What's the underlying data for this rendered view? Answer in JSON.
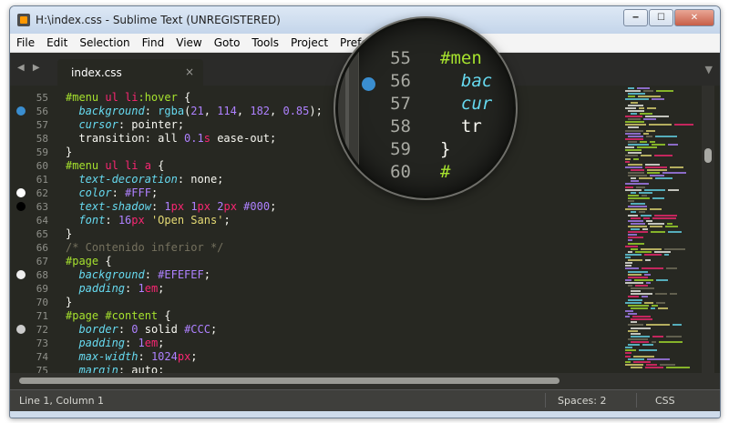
{
  "window": {
    "title": "H:\\index.css - Sublime Text (UNREGISTERED)",
    "buttons": {
      "minimize": "🗕",
      "maximize": "☐",
      "close": "✕"
    }
  },
  "menu": [
    "File",
    "Edit",
    "Selection",
    "Find",
    "View",
    "Goto",
    "Tools",
    "Project",
    "Prefer"
  ],
  "tabbar": {
    "nav": "◀ ▶",
    "tab_label": "index.css",
    "tab_close": "×",
    "menu_arrow": "▼"
  },
  "editor": {
    "lines": [
      {
        "n": "55",
        "dot": null,
        "tokens": [
          [
            "k",
            "#menu "
          ],
          [
            "t",
            "ul li"
          ],
          [
            "k",
            ":hover"
          ],
          [
            "w",
            " {"
          ]
        ]
      },
      {
        "n": "56",
        "dot": "#3a8ed0",
        "tokens": [
          [
            "w",
            "  "
          ],
          [
            "p",
            "background"
          ],
          [
            "w",
            ": "
          ],
          [
            "v",
            "rgba"
          ],
          [
            "w",
            "("
          ],
          [
            "n",
            "21"
          ],
          [
            "w",
            ", "
          ],
          [
            "n",
            "114"
          ],
          [
            "w",
            ", "
          ],
          [
            "n",
            "182"
          ],
          [
            "w",
            ", "
          ],
          [
            "n",
            "0.85"
          ],
          [
            "w",
            ");"
          ]
        ]
      },
      {
        "n": "57",
        "dot": null,
        "tokens": [
          [
            "w",
            "  "
          ],
          [
            "p",
            "cursor"
          ],
          [
            "w",
            ": pointer;"
          ]
        ]
      },
      {
        "n": "58",
        "dot": null,
        "tokens": [
          [
            "w",
            "  transition: all "
          ],
          [
            "n",
            "0.1"
          ],
          [
            "t",
            "s"
          ],
          [
            "w",
            " ease-out;"
          ]
        ]
      },
      {
        "n": "59",
        "dot": null,
        "tokens": [
          [
            "w",
            "}"
          ]
        ]
      },
      {
        "n": "60",
        "dot": null,
        "tokens": [
          [
            "k",
            "#menu "
          ],
          [
            "t",
            "ul li a"
          ],
          [
            "w",
            " {"
          ]
        ]
      },
      {
        "n": "61",
        "dot": null,
        "tokens": [
          [
            "w",
            "  "
          ],
          [
            "p",
            "text-decoration"
          ],
          [
            "w",
            ": none;"
          ]
        ]
      },
      {
        "n": "62",
        "dot": "#ffffff",
        "tokens": [
          [
            "w",
            "  "
          ],
          [
            "p",
            "color"
          ],
          [
            "w",
            ": "
          ],
          [
            "n",
            "#FFF"
          ],
          [
            "w",
            ";"
          ]
        ]
      },
      {
        "n": "63",
        "dot": "#000000",
        "tokens": [
          [
            "w",
            "  "
          ],
          [
            "p",
            "text-shadow"
          ],
          [
            "w",
            ": "
          ],
          [
            "n",
            "1"
          ],
          [
            "t",
            "px"
          ],
          [
            "w",
            " "
          ],
          [
            "n",
            "1"
          ],
          [
            "t",
            "px"
          ],
          [
            "w",
            " "
          ],
          [
            "n",
            "2"
          ],
          [
            "t",
            "px"
          ],
          [
            "w",
            " "
          ],
          [
            "n",
            "#000"
          ],
          [
            "w",
            ";"
          ]
        ]
      },
      {
        "n": "64",
        "dot": null,
        "tokens": [
          [
            "w",
            "  "
          ],
          [
            "p",
            "font"
          ],
          [
            "w",
            ": "
          ],
          [
            "n",
            "16"
          ],
          [
            "t",
            "px"
          ],
          [
            "w",
            " "
          ],
          [
            "s",
            "'Open Sans'"
          ],
          [
            "w",
            ";"
          ]
        ]
      },
      {
        "n": "65",
        "dot": null,
        "tokens": [
          [
            "w",
            "}"
          ]
        ]
      },
      {
        "n": "66",
        "dot": null,
        "tokens": [
          [
            "c",
            "/* Contenido inferior */"
          ]
        ]
      },
      {
        "n": "67",
        "dot": null,
        "tokens": [
          [
            "k",
            "#page"
          ],
          [
            "w",
            " {"
          ]
        ]
      },
      {
        "n": "68",
        "dot": "#efefef",
        "tokens": [
          [
            "w",
            "  "
          ],
          [
            "p",
            "background"
          ],
          [
            "w",
            ": "
          ],
          [
            "n",
            "#EFEFEF"
          ],
          [
            "w",
            ";"
          ]
        ]
      },
      {
        "n": "69",
        "dot": null,
        "tokens": [
          [
            "w",
            "  "
          ],
          [
            "p",
            "padding"
          ],
          [
            "w",
            ": "
          ],
          [
            "n",
            "1"
          ],
          [
            "t",
            "em"
          ],
          [
            "w",
            ";"
          ]
        ]
      },
      {
        "n": "70",
        "dot": null,
        "tokens": [
          [
            "w",
            "}"
          ]
        ]
      },
      {
        "n": "71",
        "dot": null,
        "tokens": [
          [
            "k",
            "#page #content"
          ],
          [
            "w",
            " {"
          ]
        ]
      },
      {
        "n": "72",
        "dot": "#cccccc",
        "tokens": [
          [
            "w",
            "  "
          ],
          [
            "p",
            "border"
          ],
          [
            "w",
            ": "
          ],
          [
            "n",
            "0"
          ],
          [
            "w",
            " solid "
          ],
          [
            "n",
            "#CCC"
          ],
          [
            "w",
            ";"
          ]
        ]
      },
      {
        "n": "73",
        "dot": null,
        "tokens": [
          [
            "w",
            "  "
          ],
          [
            "p",
            "padding"
          ],
          [
            "w",
            ": "
          ],
          [
            "n",
            "1"
          ],
          [
            "t",
            "em"
          ],
          [
            "w",
            ";"
          ]
        ]
      },
      {
        "n": "74",
        "dot": null,
        "tokens": [
          [
            "w",
            "  "
          ],
          [
            "p",
            "max-width"
          ],
          [
            "w",
            ": "
          ],
          [
            "n",
            "1024"
          ],
          [
            "t",
            "px"
          ],
          [
            "w",
            ";"
          ]
        ]
      },
      {
        "n": "75",
        "dot": null,
        "tokens": [
          [
            "w",
            "  "
          ],
          [
            "p",
            "margin"
          ],
          [
            "w",
            ": auto;"
          ]
        ]
      }
    ]
  },
  "magnifier": {
    "lines": [
      {
        "n": "55",
        "dot": null,
        "tokens": [
          [
            "k",
            "#men"
          ]
        ]
      },
      {
        "n": "56",
        "dot": "#3a8ed0",
        "tokens": [
          [
            "w",
            "  "
          ],
          [
            "p",
            "bac"
          ]
        ]
      },
      {
        "n": "57",
        "dot": null,
        "tokens": [
          [
            "w",
            "  "
          ],
          [
            "p",
            "cur"
          ]
        ]
      },
      {
        "n": "58",
        "dot": null,
        "tokens": [
          [
            "w",
            "  tr"
          ]
        ]
      },
      {
        "n": "59",
        "dot": null,
        "tokens": [
          [
            "w",
            "}"
          ]
        ]
      },
      {
        "n": "60",
        "dot": null,
        "tokens": [
          [
            "k",
            "#"
          ]
        ]
      }
    ]
  },
  "status": {
    "position": "Line 1, Column 1",
    "spaces": "Spaces: 2",
    "syntax": "CSS"
  },
  "colors": {
    "editor_bg": "#272822",
    "selector": "#a6e22e",
    "tag": "#f92672",
    "property": "#66d9ef",
    "number": "#ae81ff",
    "string": "#e6db74",
    "comment": "#75715e"
  }
}
